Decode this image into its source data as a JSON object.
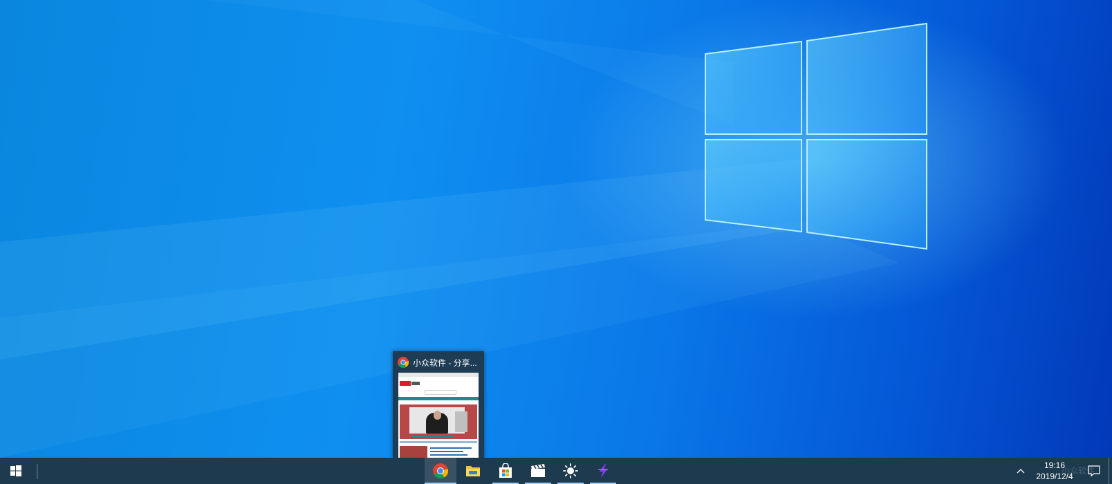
{
  "preview": {
    "title": "小众软件 - 分享..."
  },
  "taskbar": {
    "apps": [
      {
        "name": "chrome",
        "icon": "chrome-icon",
        "active": true
      },
      {
        "name": "file-explorer",
        "icon": "folder-icon"
      },
      {
        "name": "microsoft-store",
        "icon": "store-icon"
      },
      {
        "name": "video-editor",
        "icon": "clapperboard-icon"
      },
      {
        "name": "brightness",
        "icon": "sun-icon"
      },
      {
        "name": "app-purple",
        "icon": "purple-lightning-icon"
      }
    ],
    "clock_time": "19:16",
    "clock_date": "2019/12/4",
    "watermark": "小众软件"
  },
  "colors": {
    "taskbar": "#1e3a4e",
    "accent": "#0a86de",
    "indicator": "#9fd2ff"
  }
}
